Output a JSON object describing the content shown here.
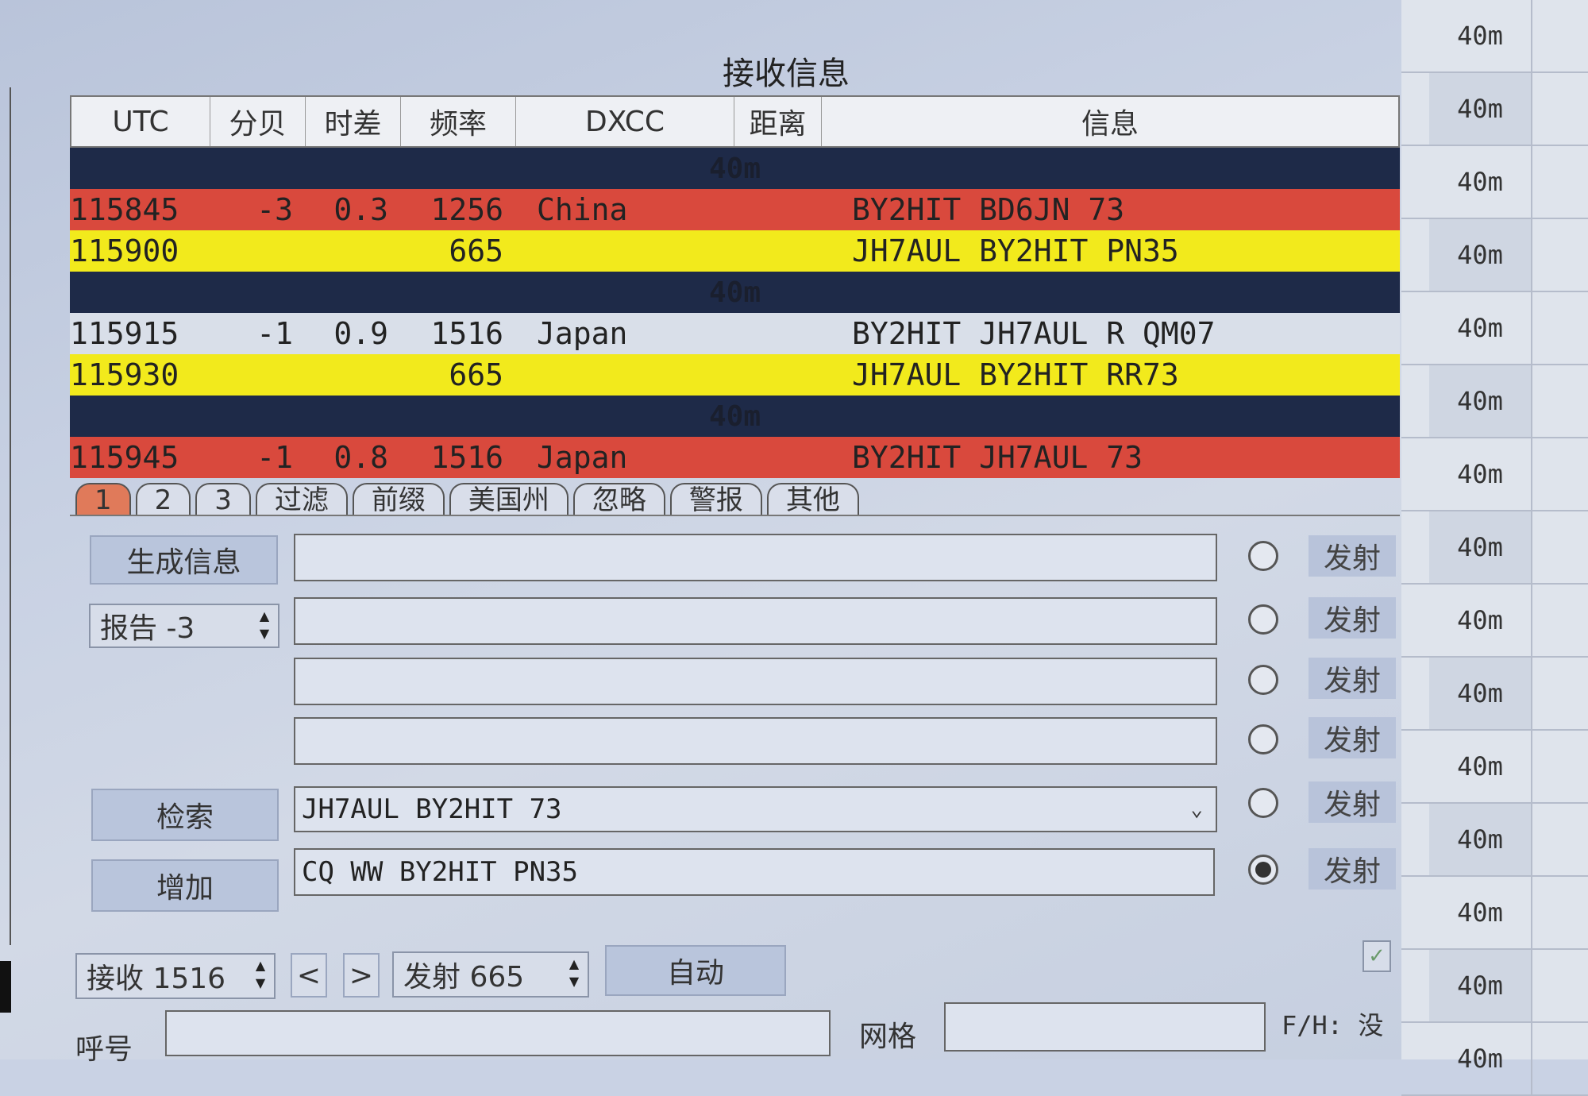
{
  "window": {
    "title": "接收信息"
  },
  "table": {
    "headers": [
      "UTC",
      "分贝",
      "时差",
      "频率",
      "DXCC",
      "距离",
      "信息"
    ],
    "rows": [
      {
        "kind": "sep",
        "band": "40m"
      },
      {
        "kind": "red",
        "utc": "115845",
        "db": "-3",
        "dt": "0.3",
        "freq": "1256",
        "dxcc": "China",
        "dist": "",
        "msg": "BY2HIT BD6JN 73"
      },
      {
        "kind": "yellow",
        "utc": "115900",
        "db": "",
        "dt": "",
        "freq": "665",
        "dxcc": "",
        "dist": "",
        "msg": "JH7AUL BY2HIT PN35"
      },
      {
        "kind": "sep",
        "band": "40m"
      },
      {
        "kind": "white",
        "utc": "115915",
        "db": "-1",
        "dt": "0.9",
        "freq": "1516",
        "dxcc": "Japan",
        "dist": "",
        "msg": "BY2HIT JH7AUL R QM07"
      },
      {
        "kind": "yellow",
        "utc": "115930",
        "db": "",
        "dt": "",
        "freq": "665",
        "dxcc": "",
        "dist": "",
        "msg": "JH7AUL BY2HIT RR73"
      },
      {
        "kind": "sep",
        "band": "40m"
      },
      {
        "kind": "red",
        "utc": "115945",
        "db": "-1",
        "dt": "0.8",
        "freq": "1516",
        "dxcc": "Japan",
        "dist": "",
        "msg": "BY2HIT JH7AUL 73"
      }
    ]
  },
  "tabs": [
    "1",
    "2",
    "3",
    "过滤",
    "前缀",
    "美国州",
    "忽略",
    "警报",
    "其他"
  ],
  "controls": {
    "generate_label": "生成信息",
    "report_label": "报告 -3",
    "search_label": "检索",
    "add_label": "增加",
    "tx_label": "发射",
    "tx_msgs": [
      "",
      "",
      "",
      "",
      "JH7AUL BY2HIT 73",
      "CQ WW BY2HIT PN35"
    ],
    "rx_freq": "接收 1516",
    "prev": "<",
    "next": ">",
    "tx_freq": "发射 665",
    "auto_label": "自动",
    "callsign_label": "呼号",
    "callsign_value": "",
    "grid_label": "网格",
    "grid_value": "",
    "fh_label": "F/H: 没"
  },
  "side_bands": [
    "40m",
    "40m",
    "40m",
    "40m",
    "40m",
    "40m",
    "40m",
    "40m",
    "40m",
    "40m",
    "40m",
    "40m",
    "40m",
    "40m",
    "40m"
  ],
  "colors": {
    "red_row": "#d9493d",
    "yellow_row": "#f2ea1c",
    "sep_row": "#1e2a48",
    "active_tab": "#e07a5a"
  }
}
